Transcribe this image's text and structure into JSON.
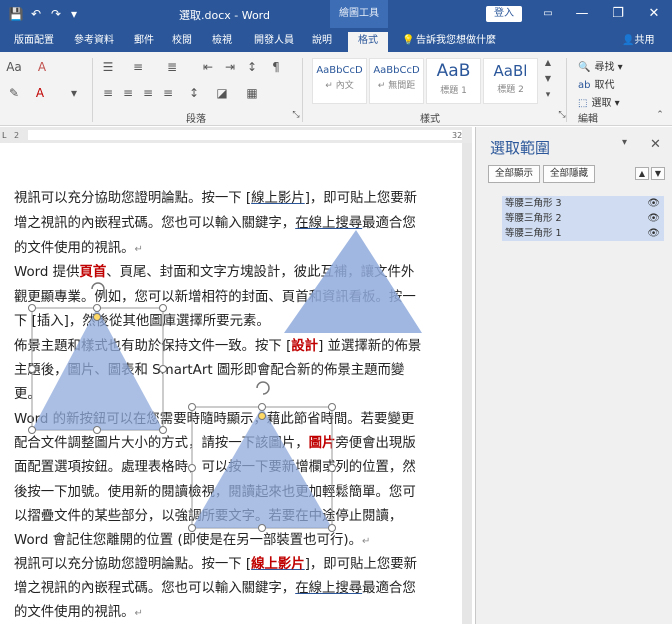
{
  "window": {
    "title": "選取.docx  -  Word",
    "tool_title": "繪圖工具",
    "signin": "登入",
    "minimize": "—",
    "restore": "❐",
    "close": "✕"
  },
  "qat": {
    "save": "💾",
    "undo": "↶",
    "redo": "↷",
    "more": "▾"
  },
  "tabs": [
    "版面配置",
    "參考資料",
    "郵件",
    "校閱",
    "檢視",
    "開發人員",
    "說明",
    "格式"
  ],
  "tell_me": "告訴我您想做什麼",
  "share": "共用",
  "ribbon": {
    "paragraph_label": "段落",
    "styles_label": "樣式",
    "editing_label": "編輯",
    "styles": [
      {
        "preview": "AaBbCcD",
        "name": "↵ 內文"
      },
      {
        "preview": "AaBbCcD",
        "name": "↵ 無間距"
      },
      {
        "preview": "AaB",
        "name": "標題 1"
      },
      {
        "preview": "AaBl",
        "name": "標題 2"
      }
    ],
    "find": "尋找",
    "replace": "取代",
    "select": "選取"
  },
  "ruler": {
    "left_num": "2",
    "right_num": "32"
  },
  "document": {
    "p1_l1a": "視訊可以充分協助您證明論點。按一下 [",
    "p1_l1b": "線上影片",
    "p1_l1c": "]，即可貼上您要新",
    "p1_l2a": "增之視訊的內嵌程式碼。您也可以輸入關鍵字，",
    "p1_l2b": "在線上搜尋",
    "p1_l2c": "最適合您",
    "p1_l3": "的文件使用的視訊。",
    "p2_l1a": "Word 提供",
    "p2_l1b": "頁首",
    "p2_l1c": "、頁尾、封面和文字方塊設計，彼此互補，讓文件外",
    "p2_l2": "觀更顯專業。例如，您可以新增相符的封面、頁首和資訊看板。按一",
    "p2_l3": "下 [插入]，然後從其他圖庫選擇所要元素。",
    "p3_l1a": "佈景主題和樣式也有助於保持文件一致。按下 [",
    "p3_l1b": "設計",
    "p3_l1c": "] 並選擇新的佈景",
    "p3_l2": "主題後，圖片、圖表和 SmartArt 圖形即會配合新的佈景主題而變",
    "p3_l3": "更。",
    "p4_l1": "Word 的新按鈕可以在您需要時隨時顯示，藉此節省時間。若要變更",
    "p4_l2a": "配合文件調整圖片大小的方式，請按一下該圖片，",
    "p4_l2b": "圖片",
    "p4_l2c": "旁便會出現版",
    "p4_l3": "面配置選項按鈕。處理表格時，可以按一下要新增欄或列的位置，然",
    "p4_l4": "後按一下加號。使用新的閱讀檢視，閱讀起來也更加輕鬆簡單。您可",
    "p4_l5": "以摺疊文件的某些部分，以強調所要文字。若要在中途停止閱讀，",
    "p4_l6": "Word 會記住您離開的位置 (即使是在另一部裝置也可行)。",
    "p5_l1a": "視訊可以充分協助您證明論點。按一下 [",
    "p5_l1b": "線上影片",
    "p5_l1c": "]，即可貼上您要新",
    "p5_l2a": "增之視訊的內嵌程式碼。您也可以輸入關鍵字，",
    "p5_l2b": "在線上搜尋",
    "p5_l2c": "最適合您",
    "p5_l3": "的文件使用的視訊。",
    "para_mark": "↵"
  },
  "selection_pane": {
    "title": "選取範圍",
    "show_all": "全部顯示",
    "hide_all": "全部隱藏",
    "items": [
      "等腰三角形 3",
      "等腰三角形 2",
      "等腰三角形 1"
    ],
    "eye": "👁",
    "up": "▲",
    "down": "▼",
    "options": "▾",
    "close": "✕"
  },
  "colors": {
    "word_blue": "#2b579a",
    "triangle_fill": "#8faadc",
    "highlight_red": "#c00000"
  }
}
